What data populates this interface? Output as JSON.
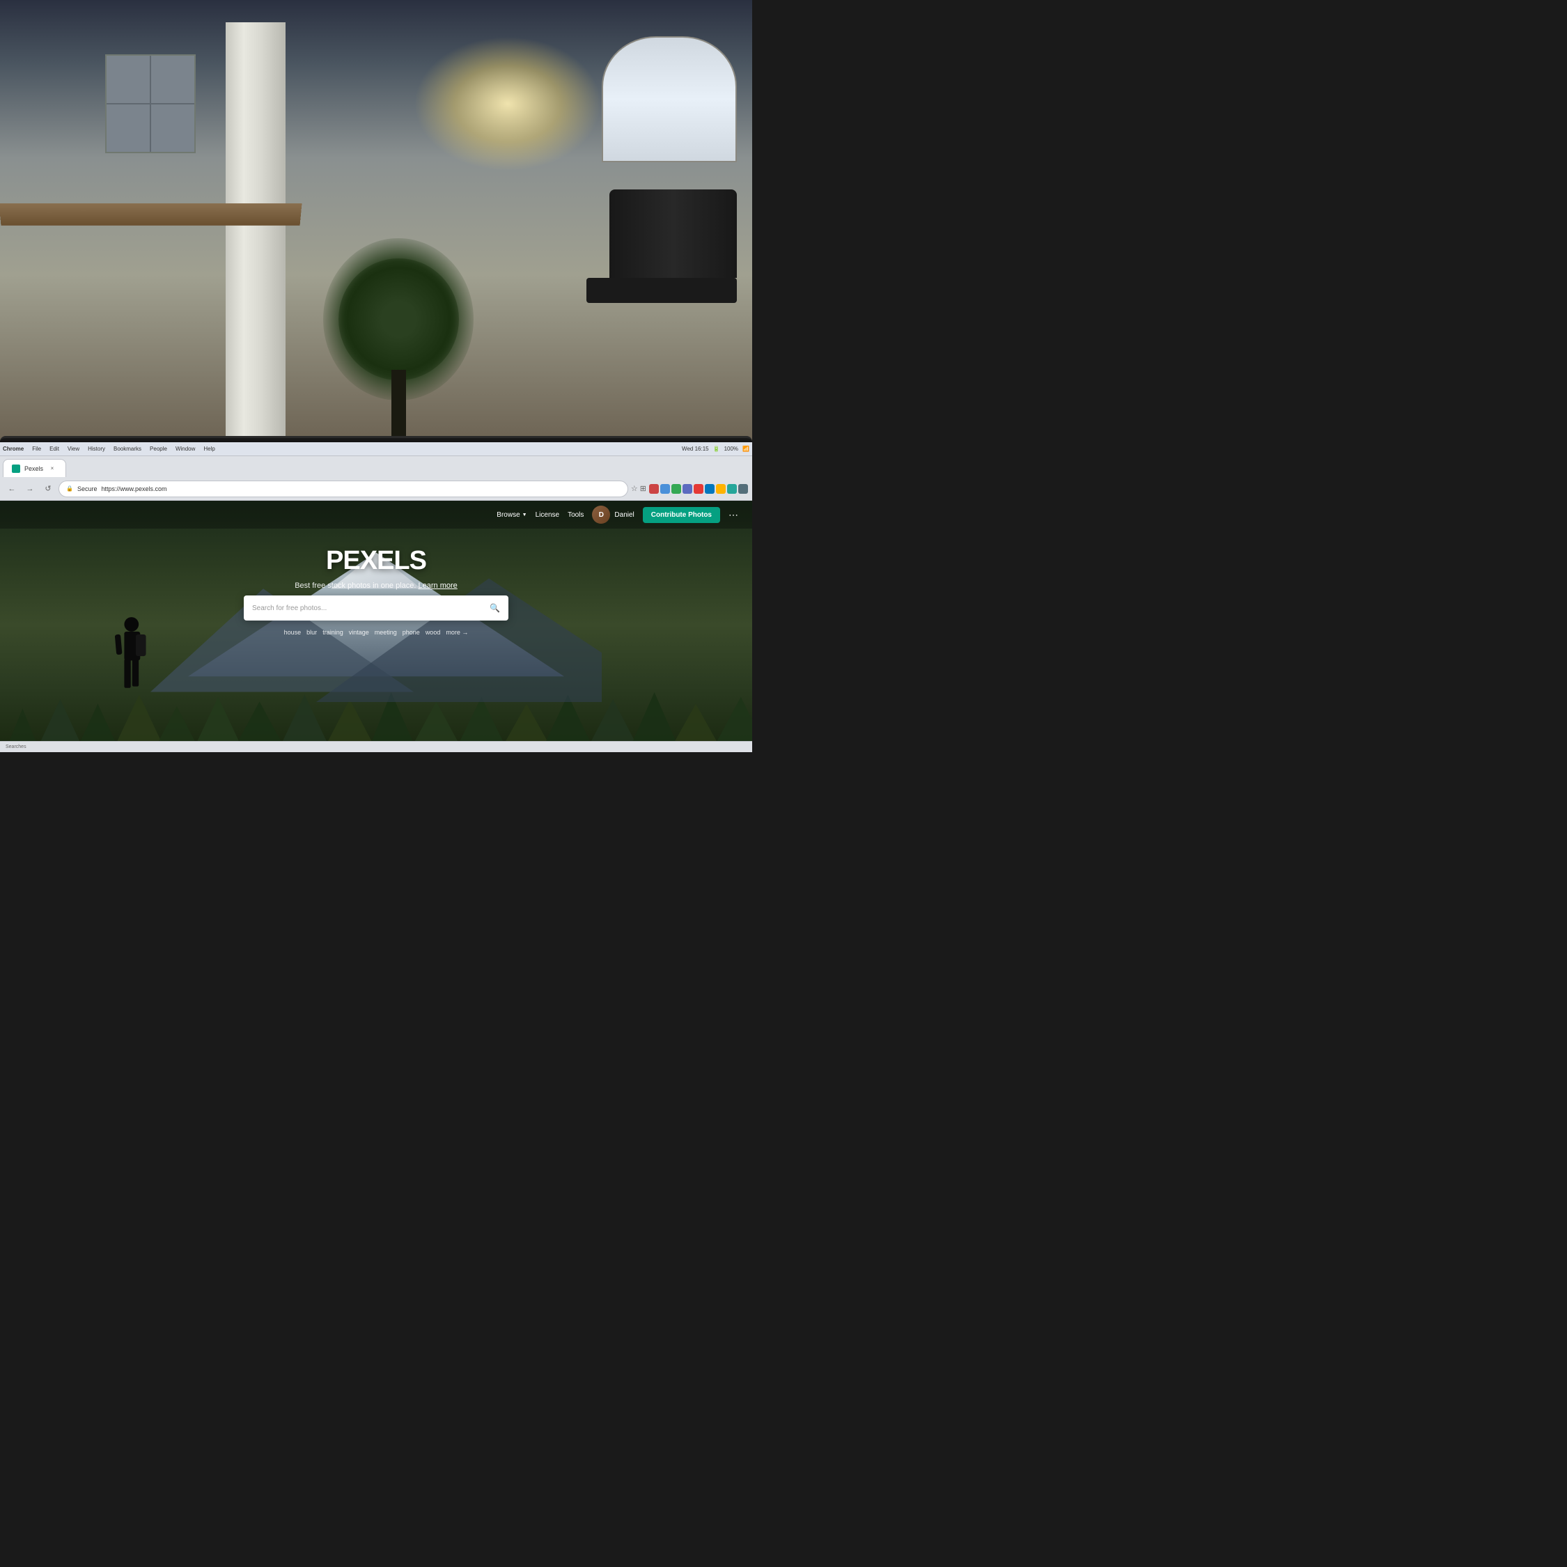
{
  "system": {
    "time": "Wed 16:15",
    "battery": "100%",
    "battery_icon": "🔋",
    "wifi_icon": "📶"
  },
  "browser": {
    "menu_items": [
      "Chrome",
      "File",
      "Edit",
      "View",
      "History",
      "Bookmarks",
      "People",
      "Window",
      "Help"
    ],
    "tab_title": "Pexels",
    "url_secure_label": "Secure",
    "url": "https://www.pexels.com",
    "back_btn": "←",
    "forward_btn": "→",
    "refresh_btn": "↺",
    "close_btn": "×"
  },
  "pexels": {
    "brand": "PEXELS",
    "tagline": "Best free stock photos in one place.",
    "tagline_link": "Learn more",
    "search_placeholder": "Search for free photos...",
    "search_tags": [
      "house",
      "blur",
      "training",
      "vintage",
      "meeting",
      "phone",
      "wood"
    ],
    "search_more": "more →",
    "nav": {
      "browse": "Browse",
      "license": "License",
      "tools": "Tools",
      "user": "Daniel",
      "contribute_btn": "Contribute Photos",
      "more": "⋯"
    }
  },
  "statusbar": {
    "text": "Searches"
  }
}
